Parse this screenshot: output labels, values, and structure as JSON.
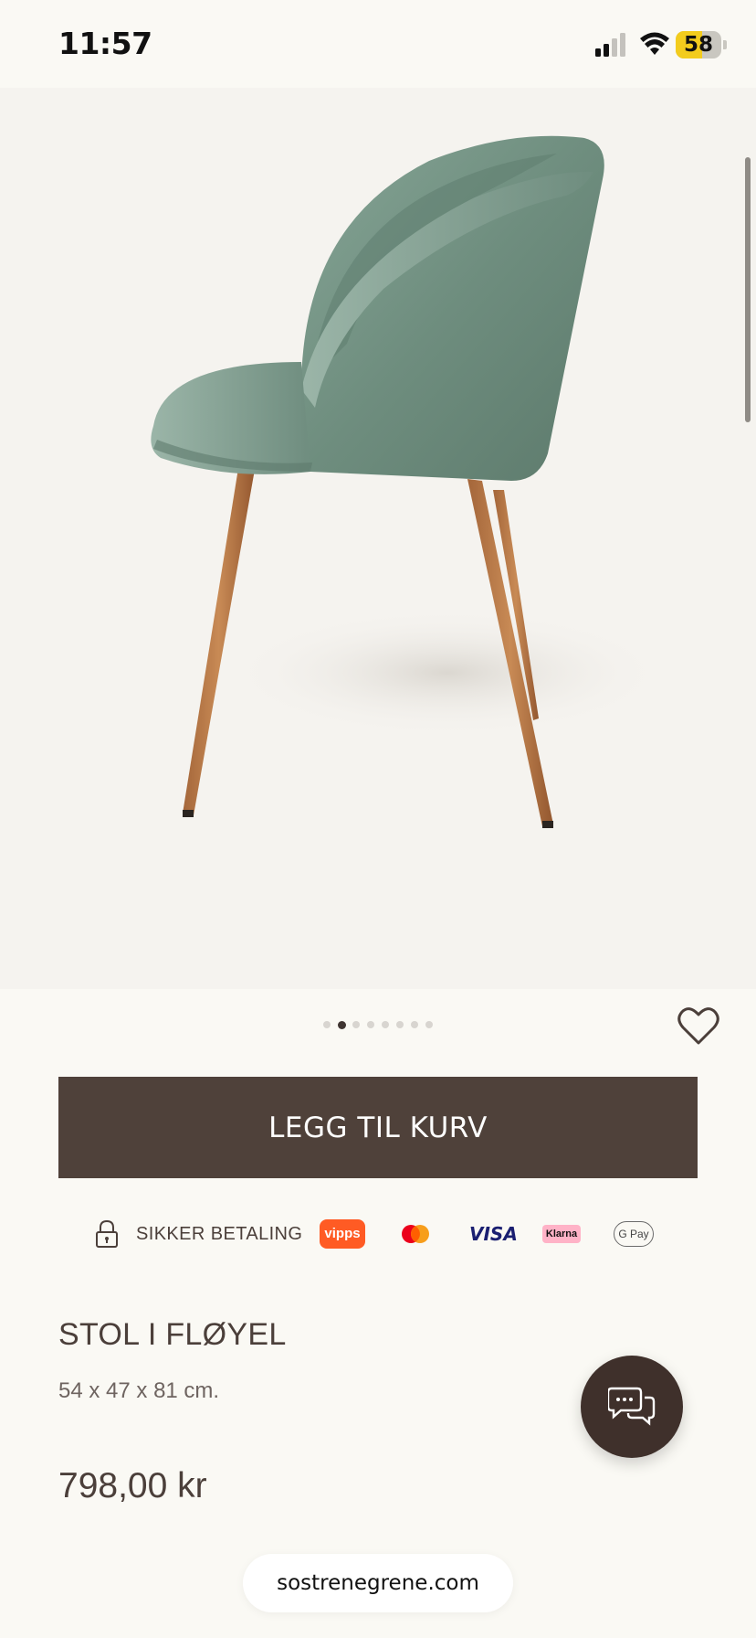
{
  "status_bar": {
    "time": "11:57",
    "battery_level": "58"
  },
  "gallery": {
    "image_count": 8,
    "active_index": 1,
    "image_subject": "chair-image"
  },
  "actions": {
    "add_to_cart_label": "LEGG TIL KURV"
  },
  "payment": {
    "secure_label": "SIKKER BETALING",
    "vipps_label": "vipps",
    "visa_label": "VISA",
    "klarna_label": "Klarna",
    "gpay_label": "G Pay"
  },
  "product": {
    "title": "STOL I FLØYEL",
    "dimensions": "54 x 47 x 81 cm.",
    "price": "798,00 kr"
  },
  "browser": {
    "url": "sostrenegrene.com"
  },
  "colors": {
    "accent": "#4f413a",
    "background": "#faf9f4",
    "chat": "#3f302b"
  },
  "icons": [
    "lock-icon",
    "heart-icon",
    "chat-icon",
    "signal-icon",
    "wifi-icon",
    "battery-icon"
  ]
}
